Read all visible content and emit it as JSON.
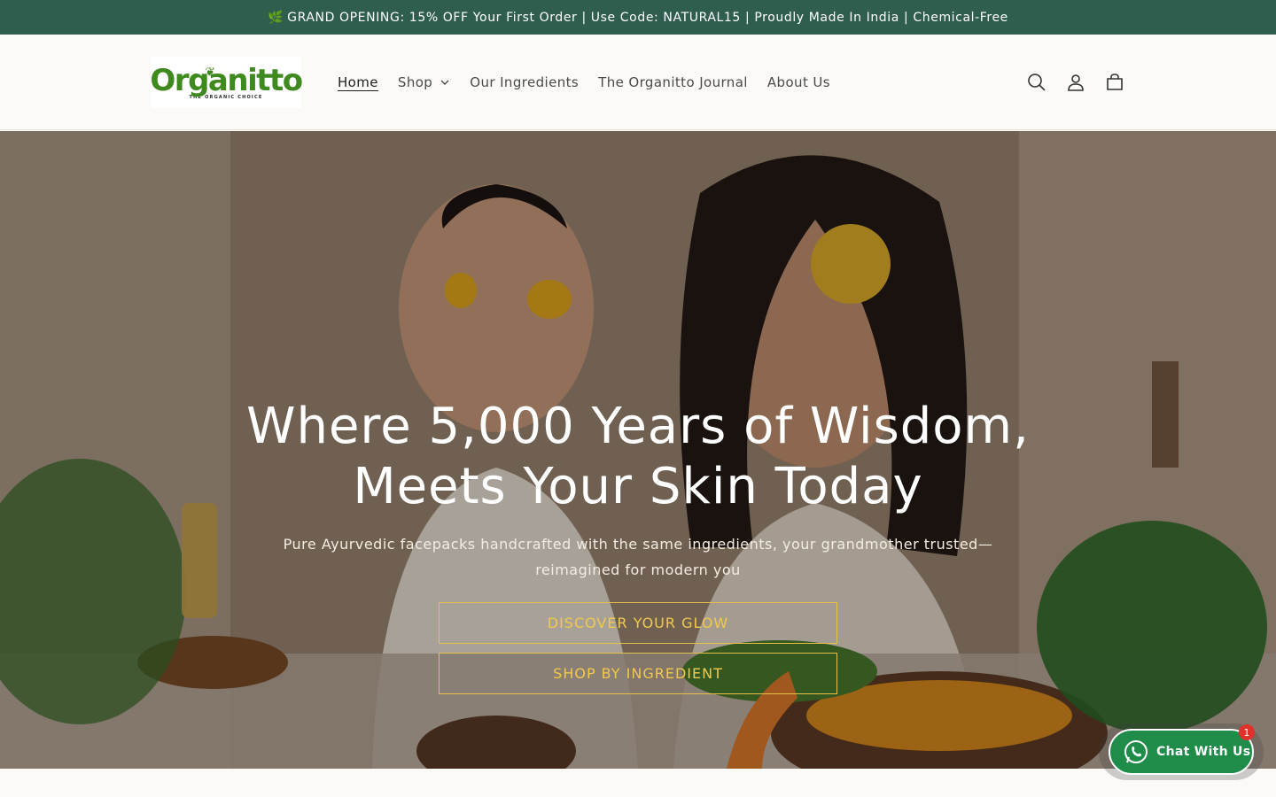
{
  "announcement": {
    "icon": "leaf-icon",
    "text": "GRAND OPENING: 15% OFF Your First Order | Use Code: NATURAL15 | Proudly Made In India | Chemical-Free"
  },
  "header": {
    "logo_text": "Organitto",
    "logo_tagline": "THE ORGANIC CHOICE",
    "nav": [
      {
        "label": "Home",
        "active": true
      },
      {
        "label": "Shop",
        "has_dropdown": true
      },
      {
        "label": "Our Ingredients"
      },
      {
        "label": "The Organitto Journal"
      },
      {
        "label": "About Us"
      }
    ],
    "icons": [
      "search-icon",
      "account-icon",
      "cart-icon"
    ]
  },
  "hero": {
    "title_line1": "Where 5,000 Years of Wisdom,",
    "title_line2": "Meets Your Skin Today",
    "subtitle": "Pure Ayurvedic facepacks handcrafted with the same ingredients, your grandmother trusted—reimagined for modern you",
    "button_primary": "DISCOVER YOUR GLOW",
    "button_secondary": "SHOP BY INGREDIENT"
  },
  "chat": {
    "label": "Chat With Us",
    "badge": "1"
  },
  "colors": {
    "announcement_bg": "#2f5e4e",
    "brand_green": "#3f8a1f",
    "button_gold": "#f2c94c",
    "chat_green": "#1f8c4a",
    "badge_red": "#e0312b"
  }
}
